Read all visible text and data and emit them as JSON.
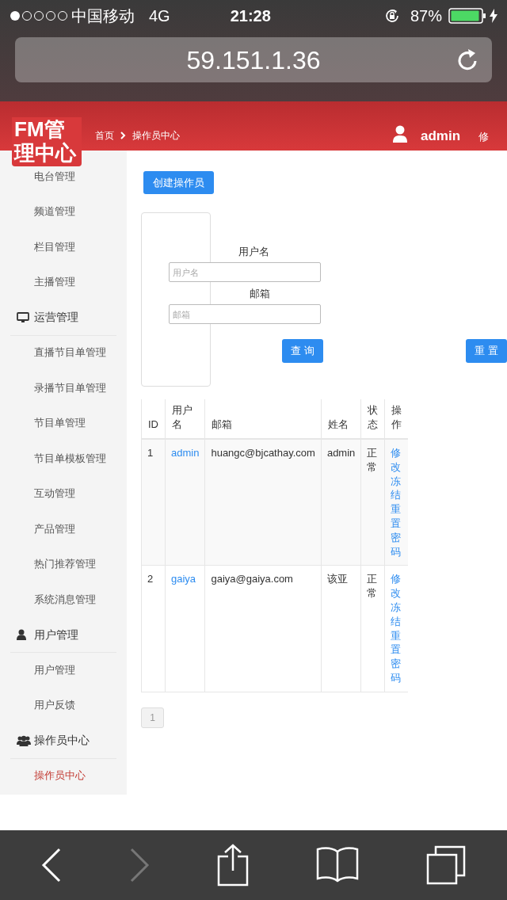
{
  "status_bar": {
    "carrier": "中国移动",
    "network": "4G",
    "time": "21:28",
    "battery": "87%"
  },
  "address_bar": {
    "url": "59.151.1.36"
  },
  "header": {
    "title": "FM管理中心",
    "breadcrumbs": [
      "首页",
      "操作员中心"
    ],
    "user": "admin",
    "link": "修"
  },
  "sidebar": {
    "sections": [
      {
        "items": [
          {
            "label": "电台管理",
            "selected": false
          },
          {
            "label": "频道管理",
            "selected": false
          },
          {
            "label": "栏目管理",
            "selected": false
          },
          {
            "label": "主播管理",
            "selected": false
          }
        ]
      },
      {
        "title": "运营管理",
        "items": [
          {
            "label": "直播节目单管理",
            "selected": false
          },
          {
            "label": "录播节目单管理",
            "selected": false
          },
          {
            "label": "节目单管理",
            "selected": false
          },
          {
            "label": "节目单模板管理",
            "selected": false
          },
          {
            "label": "互动管理",
            "selected": false
          },
          {
            "label": "产品管理",
            "selected": false
          },
          {
            "label": "热门推荐管理",
            "selected": false
          },
          {
            "label": "系统消息管理",
            "selected": false
          }
        ]
      },
      {
        "title": "用户管理",
        "items": [
          {
            "label": "用户管理",
            "selected": false
          },
          {
            "label": "用户反馈",
            "selected": false
          }
        ]
      },
      {
        "title": "操作员中心",
        "items": [
          {
            "label": "操作员中心",
            "selected": true
          }
        ]
      }
    ]
  },
  "create_button": "创建操作员",
  "filter": {
    "fields": [
      {
        "label": "用户名",
        "placeholder": "用户名"
      },
      {
        "label": "邮箱",
        "placeholder": "邮箱"
      }
    ],
    "buttons": [
      "查 询",
      "重 置"
    ]
  },
  "table": {
    "columns": [
      "ID",
      "用户名",
      "邮箱",
      "姓名",
      "状态",
      "操作"
    ],
    "rows": [
      {
        "id": "1",
        "username": "admin",
        "email": "huangc@bjcathay.com",
        "name": "admin",
        "status": "正常",
        "actions": [
          "修改",
          "冻结",
          "重置密码"
        ]
      },
      {
        "id": "2",
        "username": "gaiya",
        "email": "gaiya@gaiya.com",
        "name": "该亚",
        "status": "正常",
        "actions": [
          "修改",
          "冻结",
          "重置密码"
        ]
      }
    ]
  },
  "pagination": [
    {
      "label": "1",
      "selected": true
    }
  ]
}
